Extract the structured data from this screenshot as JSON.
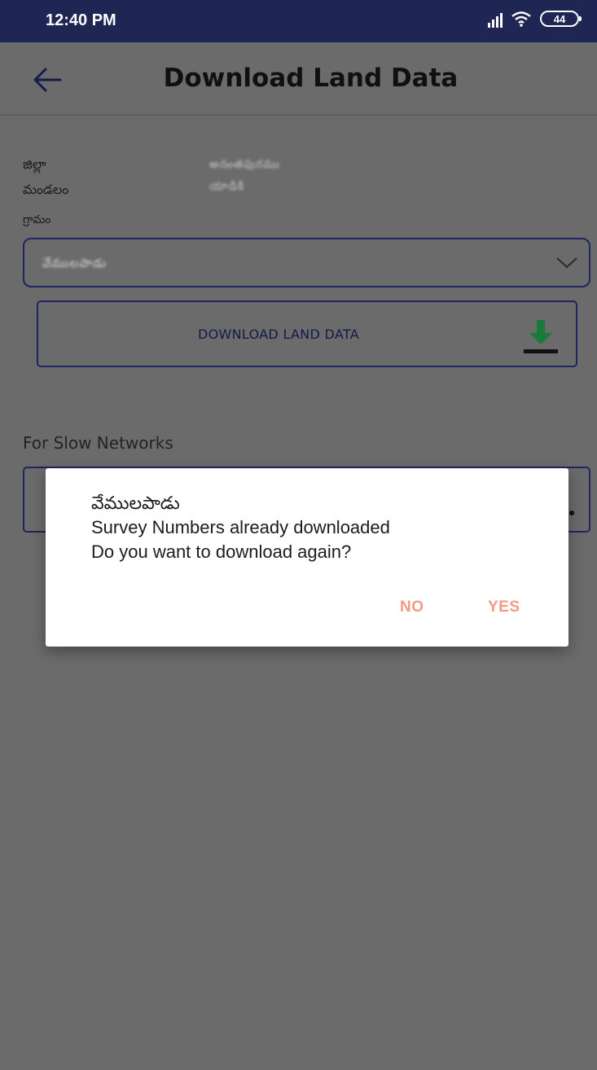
{
  "status_bar": {
    "time": "12:40 PM",
    "battery": "44",
    "icons": [
      "signal-icon",
      "wifi-icon",
      "battery-icon"
    ]
  },
  "app_bar": {
    "title": "Download Land Data",
    "back_icon": "back-arrow-icon"
  },
  "form": {
    "district_label": "జిల్లా",
    "district_value": "అనంతపురము",
    "mandal_label": "మండలం",
    "mandal_value": "యాడికి",
    "village_label": "గ్రామం",
    "village_selected": "వేములపాడు",
    "download_button_label": "DOWNLOAD LAND DATA",
    "slow_networks_label": "For Slow Networks"
  },
  "dialog": {
    "title": "వేములపాడు",
    "line1": "Survey Numbers already downloaded",
    "line2": "Do you want to download again?",
    "no_label": "NO",
    "yes_label": "YES"
  },
  "colors": {
    "status_bar": "#1f2654",
    "overlay": "#6b6b6b",
    "dialog_button": "#f49a83",
    "outline": "#1e2560",
    "download_arrow": "#1a7a3a"
  }
}
